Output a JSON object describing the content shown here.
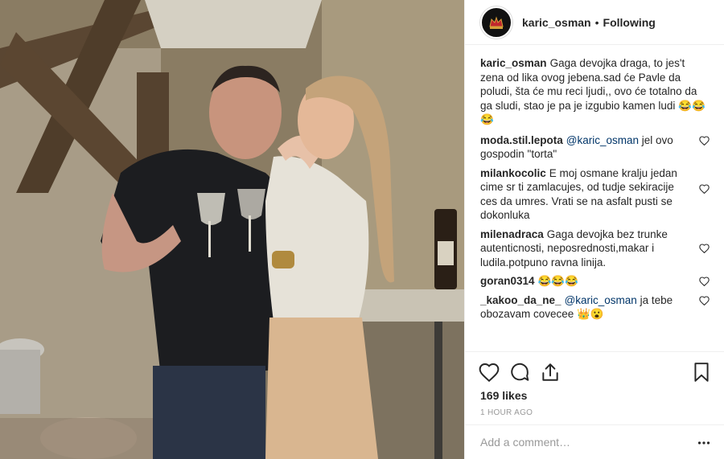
{
  "header": {
    "username": "karic_osman",
    "separator": "•",
    "follow_status": "Following"
  },
  "caption": {
    "username": "karic_osman",
    "text": "Gaga devojka draga, to jes't zena od lika ovog jebena.sad će Pavle da poludi, šta će mu reci ljudi,, ovo će totalno da ga sludi, stao je pa je izgubio kamen ludi 😂😂😂"
  },
  "comments": [
    {
      "username": "moda.stil.lepota",
      "mention": "@karic_osman",
      "text": " jel ovo gospodin \"torta\""
    },
    {
      "username": "milankocolic",
      "mention": "",
      "text": "E moj osmane kralju jedan cime sr ti zamlacujes, od tudje sekiracije ces da umres. Vrati se na asfalt pusti se dokonluka"
    },
    {
      "username": "milenadraca",
      "mention": "",
      "text": "Gaga devojka bez trunke autenticnosti, neposrednosti,makar i ludila.potpuno ravna linija."
    },
    {
      "username": "goran0314",
      "mention": "",
      "text": "😂😂😂"
    },
    {
      "username": "_kakoo_da_ne_",
      "mention": "@karic_osman",
      "text": " ja tebe obozavam covecee 👑😮"
    }
  ],
  "actions": {
    "like_icon": "heart-icon",
    "comment_icon": "speech-bubble-icon",
    "share_icon": "share-icon",
    "save_icon": "bookmark-icon"
  },
  "likes": "169 likes",
  "timestamp": "1 HOUR AGO",
  "add_comment": {
    "placeholder": "Add a comment…",
    "more_icon": "more-icon"
  },
  "colors": {
    "text": "#262626",
    "muted": "#999999",
    "mention": "#003569",
    "border": "#efefef"
  }
}
